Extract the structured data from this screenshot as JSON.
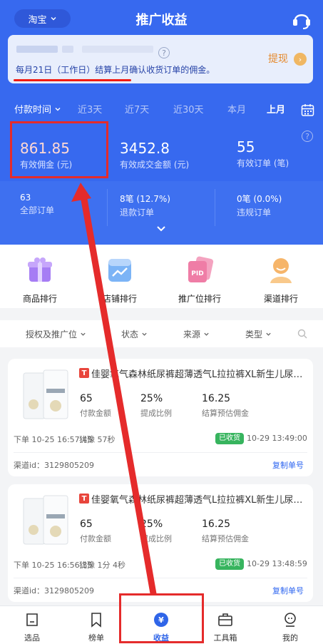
{
  "header": {
    "platform": "淘宝",
    "title": "推广收益"
  },
  "notice": {
    "question_mark": "?",
    "text": "每月21日（工作日）结算上月确认收货订单的佣金。",
    "withdraw_label": "提现",
    "withdraw_arrow": "›"
  },
  "tabs": [
    "付款时间",
    "近3天",
    "近7天",
    "近30天",
    "本月",
    "上月"
  ],
  "stats": [
    {
      "value": "861.85",
      "label": "有效佣金 (元)"
    },
    {
      "value": "3452.8",
      "label": "有效成交金额 (元)"
    },
    {
      "value": "55",
      "label": "有效订单 (笔)"
    }
  ],
  "substats": [
    {
      "value": "63",
      "label": "全部订单"
    },
    {
      "value": "8笔 (12.7%)",
      "label": "退款订单"
    },
    {
      "value": "0笔 (0.0%)",
      "label": "违规订单"
    }
  ],
  "rank_icons": [
    {
      "label": "商品排行",
      "icon": "gift-box-icon"
    },
    {
      "label": "店铺排行",
      "icon": "shop-chart-icon"
    },
    {
      "label": "推广位排行",
      "icon": "pid-card-icon"
    },
    {
      "label": "渠道排行",
      "icon": "person-icon"
    }
  ],
  "filters": [
    "授权及推广位",
    "状态",
    "来源",
    "类型"
  ],
  "orders": [
    {
      "shop_tag": "T",
      "title": "佳婴氧气森林纸尿裤超薄透气L拉拉裤XL新生儿尿不湿",
      "pay_amount": "65",
      "pay_label": "付款金额",
      "rate": "25%",
      "rate_label": "提成比例",
      "commission": "16.25",
      "commission_label": "结算预估佣金",
      "order_time": "下单 10-25 16:57:45",
      "hesitation": "犹豫 57秒",
      "status": "已收货",
      "settle_time": "10-29 13:49:00",
      "channel": "渠道id：3129805209",
      "copy_label": "复制单号"
    },
    {
      "shop_tag": "T",
      "title": "佳婴氧气森林纸尿裤超薄透气L拉拉裤XL新生儿尿不湿",
      "pay_amount": "65",
      "pay_label": "付款金额",
      "rate": "25%",
      "rate_label": "提成比例",
      "commission": "16.25",
      "commission_label": "结算预估佣金",
      "order_time": "下单 10-25 16:56:35",
      "hesitation": "犹豫 1分 4秒",
      "status": "已收货",
      "settle_time": "10-29 13:48:59",
      "channel": "渠道id：3129805209",
      "copy_label": "复制单号"
    }
  ],
  "bottom_nav": [
    {
      "label": "选品",
      "icon": "select-product-icon"
    },
    {
      "label": "榜单",
      "icon": "bookmark-icon"
    },
    {
      "label": "收益",
      "icon": "yen-coin-icon",
      "active": true
    },
    {
      "label": "工具箱",
      "icon": "toolbox-icon"
    },
    {
      "label": "我的",
      "icon": "profile-icon"
    }
  ],
  "colors": {
    "primary": "#3769ef",
    "accent_red": "#e52b2b",
    "received_green": "#37b45e",
    "withdraw_orange": "#e58a2e"
  }
}
